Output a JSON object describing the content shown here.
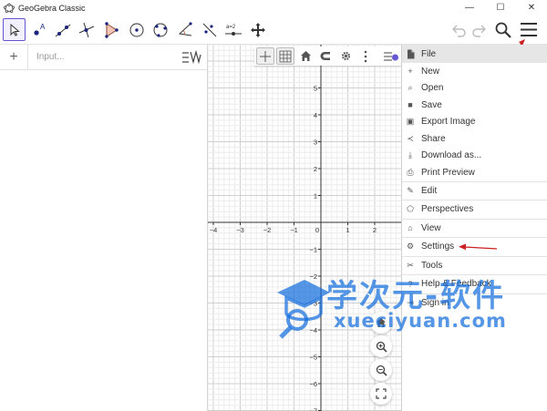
{
  "window": {
    "title": "GeoGebra Classic",
    "controls": [
      "—",
      "☐",
      "✕"
    ]
  },
  "algebra": {
    "input_placeholder": "Input...",
    "add_symbol": "+"
  },
  "graphics": {
    "x_ticks": [
      "−4",
      "−3",
      "−2",
      "−1",
      "0",
      "1",
      "2"
    ],
    "y_ticks": [
      "5",
      "4",
      "3",
      "2",
      "1",
      "−1",
      "−2",
      "−3",
      "−4",
      "−5",
      "−6",
      "−7"
    ]
  },
  "menu": {
    "file_label": "File",
    "file_items": [
      {
        "label": "New",
        "icon": "plus-icon",
        "glyph": "+"
      },
      {
        "label": "Open",
        "icon": "search-icon",
        "glyph": "⌕"
      },
      {
        "label": "Save",
        "icon": "save-icon",
        "glyph": "■"
      },
      {
        "label": "Export Image",
        "icon": "image-icon",
        "glyph": "▣"
      },
      {
        "label": "Share",
        "icon": "share-icon",
        "glyph": "≺"
      },
      {
        "label": "Download as...",
        "icon": "download-icon",
        "glyph": "⤓"
      },
      {
        "label": "Print Preview",
        "icon": "print-icon",
        "glyph": "⎙"
      }
    ],
    "groups": [
      {
        "label": "Edit",
        "icon": "pencil-icon",
        "glyph": "✎"
      },
      {
        "label": "Perspectives",
        "icon": "pentagon-icon",
        "glyph": "⬠"
      },
      {
        "label": "View",
        "icon": "home-icon",
        "glyph": "⌂"
      },
      {
        "label": "Settings",
        "icon": "gear-icon",
        "glyph": "⚙"
      },
      {
        "label": "Tools",
        "icon": "tools-icon",
        "glyph": "✂"
      },
      {
        "label": "Help & Feedback",
        "icon": "help-icon",
        "glyph": "?"
      },
      {
        "label": "Sign in",
        "icon": "sign-in-icon",
        "glyph": "⇥"
      }
    ]
  },
  "watermark": {
    "text": "学次元-软件",
    "url": "xueciyuan.com"
  },
  "colors": {
    "accent": "#6557d2",
    "annotation_arrow": "#cc1f1f",
    "watermark": "#146edc"
  }
}
